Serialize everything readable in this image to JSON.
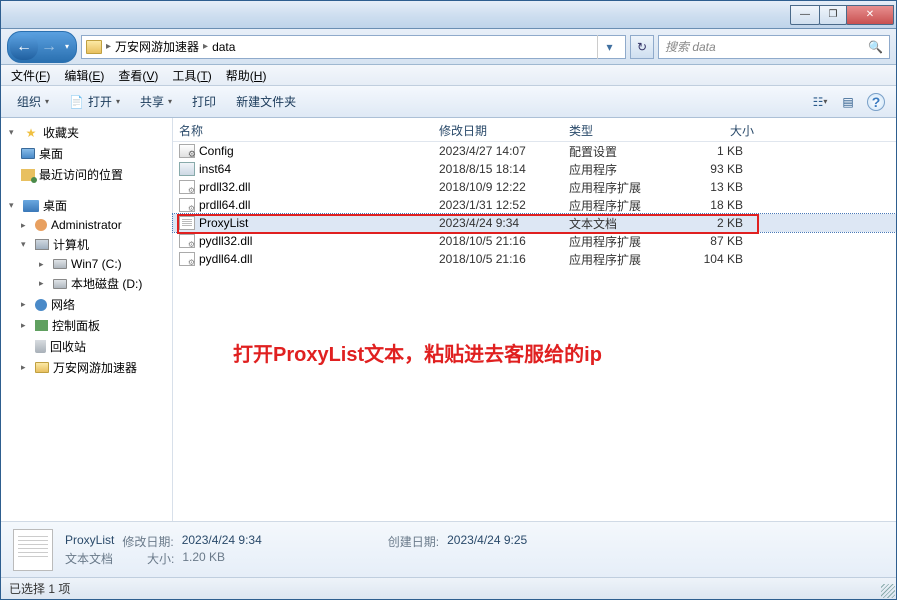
{
  "titlebar": {
    "min": "—",
    "max": "❐",
    "close": "✕"
  },
  "nav": {
    "back": "←",
    "fwd": "→",
    "drop": "▾",
    "breadcrumb": {
      "root_icon": "folder",
      "parts": [
        "万安网游加速器",
        "data"
      ],
      "sep": "▸"
    },
    "refresh": "↻",
    "go": "→",
    "search_placeholder": "搜索 data"
  },
  "menubar": [
    {
      "label": "文件",
      "mn": "F"
    },
    {
      "label": "编辑",
      "mn": "E"
    },
    {
      "label": "查看",
      "mn": "V"
    },
    {
      "label": "工具",
      "mn": "T"
    },
    {
      "label": "帮助",
      "mn": "H"
    }
  ],
  "toolbar": {
    "organize": "组织",
    "open": "打开",
    "share": "共享",
    "print": "打印",
    "newfolder": "新建文件夹",
    "drop": "▾",
    "view": "☷",
    "preview": "▤",
    "help": "?"
  },
  "sidebar": {
    "fav_label": "收藏夹",
    "fav_items": [
      {
        "label": "桌面",
        "ico": "ico-desk"
      },
      {
        "label": "最近访问的位置",
        "ico": "ico-recent"
      }
    ],
    "desktop_label": "桌面",
    "desktop_items": [
      {
        "label": "Administrator",
        "ico": "ico-user",
        "arrow": "▸"
      },
      {
        "label": "计算机",
        "ico": "ico-computer",
        "arrow": "▾",
        "children": [
          {
            "label": "Win7 (C:)",
            "ico": "ico-drive",
            "arrow": "▸"
          },
          {
            "label": "本地磁盘 (D:)",
            "ico": "ico-drive",
            "arrow": "▸"
          }
        ]
      },
      {
        "label": "网络",
        "ico": "ico-net",
        "arrow": "▸"
      },
      {
        "label": "控制面板",
        "ico": "ico-panel",
        "arrow": "▸"
      },
      {
        "label": "回收站",
        "ico": "ico-trash"
      },
      {
        "label": "万安网游加速器",
        "ico": "ico-folder",
        "arrow": "▸"
      }
    ]
  },
  "columns": {
    "name": "名称",
    "date": "修改日期",
    "type": "类型",
    "size": "大小"
  },
  "files": [
    {
      "name": "Config",
      "date": "2023/4/27 14:07",
      "type": "配置设置",
      "size": "1 KB",
      "ico": "fico-cfg",
      "sel": false
    },
    {
      "name": "inst64",
      "date": "2018/8/15 18:14",
      "type": "应用程序",
      "size": "93 KB",
      "ico": "fico-exe",
      "sel": false
    },
    {
      "name": "prdll32.dll",
      "date": "2018/10/9 12:22",
      "type": "应用程序扩展",
      "size": "13 KB",
      "ico": "fico-dll",
      "sel": false
    },
    {
      "name": "prdll64.dll",
      "date": "2023/1/31 12:52",
      "type": "应用程序扩展",
      "size": "18 KB",
      "ico": "fico-dll",
      "sel": false
    },
    {
      "name": "ProxyList",
      "date": "2023/4/24 9:34",
      "type": "文本文档",
      "size": "2 KB",
      "ico": "fico-txt",
      "sel": true
    },
    {
      "name": "pydll32.dll",
      "date": "2018/10/5 21:16",
      "type": "应用程序扩展",
      "size": "87 KB",
      "ico": "fico-dll",
      "sel": false
    },
    {
      "name": "pydll64.dll",
      "date": "2018/10/5 21:16",
      "type": "应用程序扩展",
      "size": "104 KB",
      "ico": "fico-dll",
      "sel": false
    }
  ],
  "annotation": "打开ProxyList文本，粘贴进去客服给的ip",
  "details": {
    "name": "ProxyList",
    "type": "文本文档",
    "mod_label": "修改日期:",
    "mod_value": "2023/4/24 9:34",
    "created_label": "创建日期:",
    "created_value": "2023/4/24 9:25",
    "size_label": "大小:",
    "size_value": "1.20 KB"
  },
  "status": "已选择 1 项"
}
